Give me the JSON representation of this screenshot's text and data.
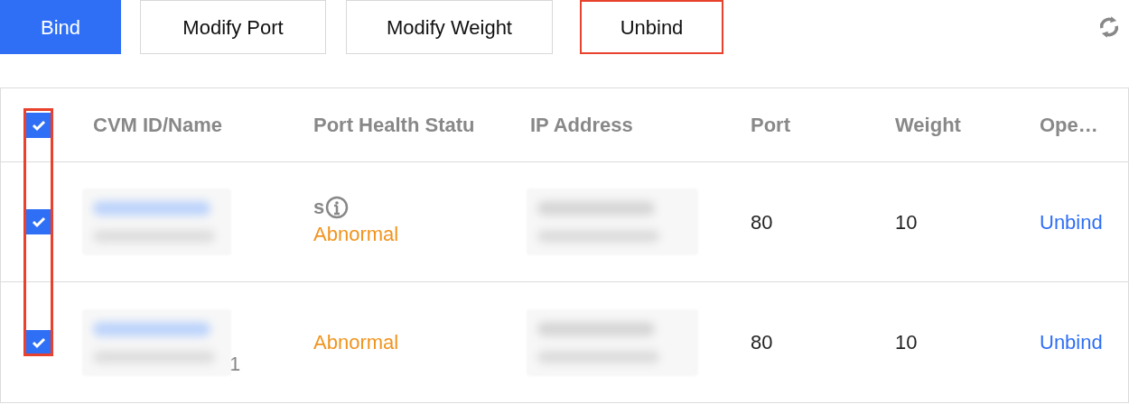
{
  "toolbar": {
    "buttons": [
      {
        "label": "Bind",
        "kind": "primary",
        "highlighted": false
      },
      {
        "label": "Modify Port",
        "kind": "default",
        "highlighted": false
      },
      {
        "label": "Modify Weight",
        "kind": "default",
        "highlighted": false
      },
      {
        "label": "Unbind",
        "kind": "default",
        "highlighted": true
      }
    ]
  },
  "table": {
    "select_all": {
      "checked": true
    },
    "checkbox_column_highlighted": true,
    "columns": [
      "CVM ID/Name",
      "Port Health Statu",
      "IP Address",
      "Port",
      "Weight",
      "Ope…"
    ],
    "rows": [
      {
        "checked": true,
        "cvm_blurred": true,
        "cvm_suffix": null,
        "status_note": "s",
        "status": "Abnormal",
        "ip_blurred": true,
        "port": "80",
        "weight": "10",
        "action": "Unbind"
      },
      {
        "checked": true,
        "cvm_blurred": true,
        "cvm_suffix": "1",
        "status_note": null,
        "status": "Abnormal",
        "ip_blurred": true,
        "port": "80",
        "weight": "10",
        "action": "Unbind"
      }
    ]
  }
}
